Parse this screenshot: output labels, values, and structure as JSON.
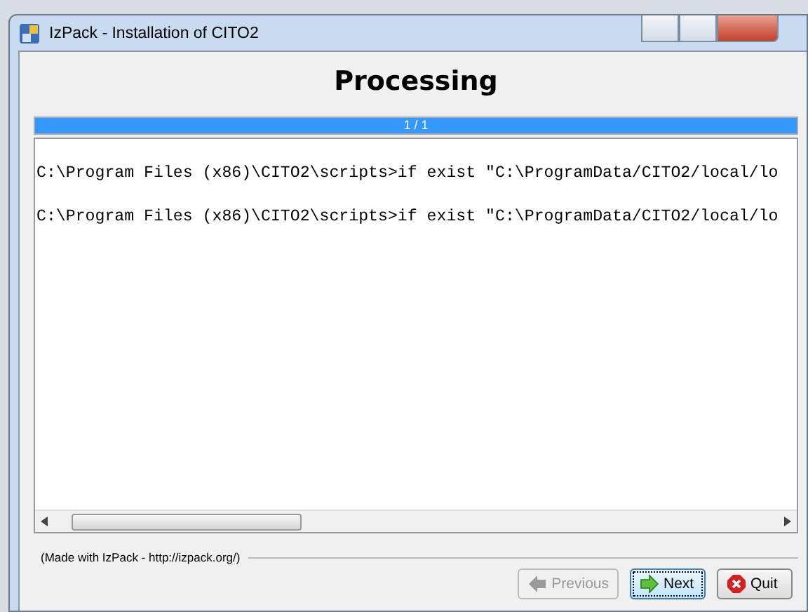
{
  "window": {
    "title": "IzPack - Installation of  CITO2"
  },
  "heading": "Processing",
  "progress": {
    "level": 1,
    "reading": "1 / 1"
  },
  "log_lines": [
    "C:\\Program Files (x86)\\CITO2\\scripts>if exist \"C:\\ProgramData/CITO2/local/lo",
    "C:\\Program Files (x86)\\CITO2\\scripts>if exist \"C:\\ProgramData/CITO2/local/lo"
  ],
  "footer": "(Made with IzPack - http://izpack.org/)",
  "buttons": [
    {
      "label": "Previous",
      "kind": "previous",
      "disabled": true,
      "focused": false
    },
    {
      "label": "Next",
      "kind": "next",
      "disabled": false,
      "focused": true
    },
    {
      "label": "Quit",
      "kind": "quit",
      "disabled": false,
      "focused": false
    }
  ]
}
